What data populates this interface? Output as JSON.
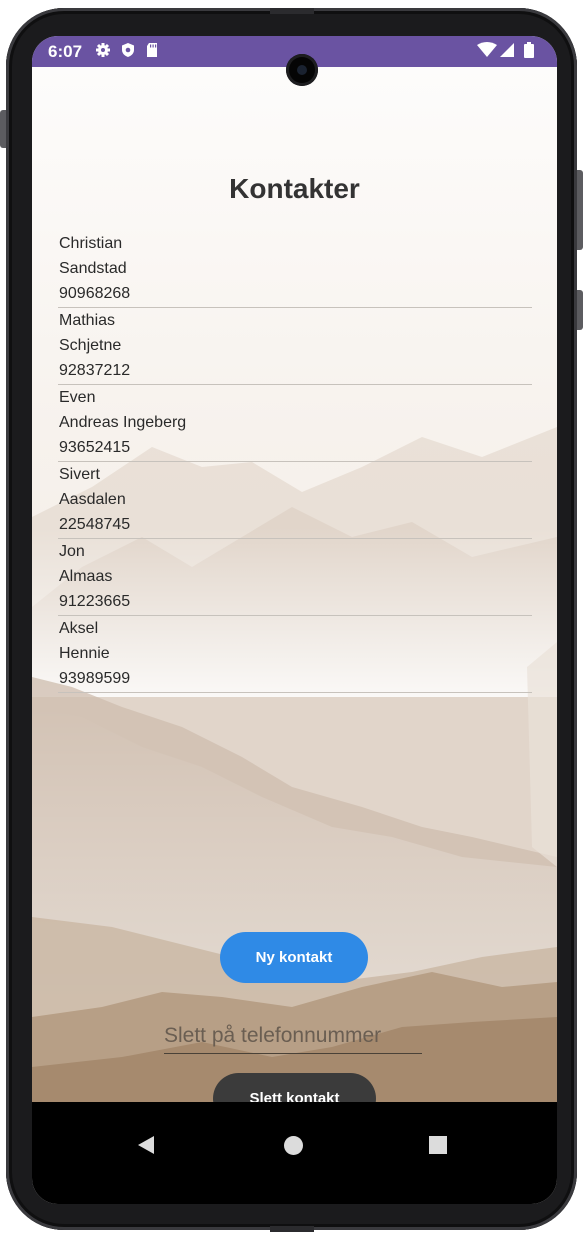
{
  "status_bar": {
    "time": "6:07",
    "icons": [
      "gear-icon",
      "shield-icon",
      "sd-card-icon",
      "wifi-icon",
      "signal-icon",
      "battery-icon"
    ],
    "color": "#6a53a2"
  },
  "page": {
    "title": "Kontakter"
  },
  "contacts": [
    {
      "first_name": "Christian",
      "last_name": "Sandstad",
      "phone": "90968268"
    },
    {
      "first_name": "Mathias",
      "last_name": "Schjetne",
      "phone": "92837212"
    },
    {
      "first_name": "Even",
      "last_name": "Andreas Ingeberg",
      "phone": "93652415"
    },
    {
      "first_name": "Sivert",
      "last_name": "Aasdalen",
      "phone": "22548745"
    },
    {
      "first_name": "Jon",
      "last_name": "Almaas",
      "phone": "91223665"
    },
    {
      "first_name": "Aksel",
      "last_name": "Hennie",
      "phone": "93989599"
    }
  ],
  "actions": {
    "new_contact_label": "Ny kontakt",
    "delete_input_placeholder": "Slett på telefonnummer",
    "delete_input_value": "",
    "delete_contact_label": "Slett kontakt"
  },
  "nav_bar": {
    "buttons": [
      "back-icon",
      "home-icon",
      "recents-icon"
    ]
  },
  "colors": {
    "primary_button": "#2f8ae6",
    "dark_button": "#3b3b3b"
  }
}
